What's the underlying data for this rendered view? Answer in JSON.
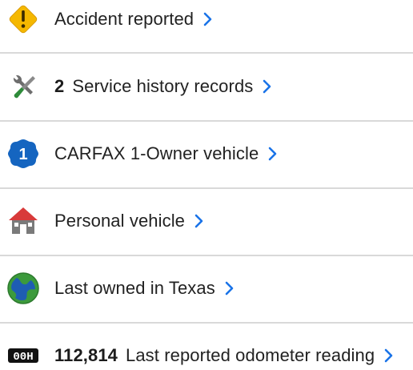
{
  "items": [
    {
      "label": "Accident reported",
      "icon": "warning-diamond-icon"
    },
    {
      "count": "2",
      "label": "Service history records",
      "icon": "wrench-screwdriver-icon"
    },
    {
      "label": "CARFAX 1-Owner vehicle",
      "icon": "one-owner-badge-icon",
      "badge_text": "1"
    },
    {
      "label": "Personal vehicle",
      "icon": "house-icon"
    },
    {
      "label": "Last owned in Texas",
      "icon": "globe-icon"
    },
    {
      "count": "112,814",
      "label": "Last reported odometer reading",
      "icon": "odometer-icon",
      "odometer_text": "00H"
    }
  ],
  "colors": {
    "warning": "#f5b800",
    "badge": "#1565c0",
    "house_roof": "#d83a3a",
    "house_body": "#7a7a7a",
    "globe_land": "#3c9a3c",
    "globe_sea": "#1e5db3",
    "tool_green": "#2e8b3a",
    "chevron": "#1a73e8",
    "divider": "#d9d9d9"
  }
}
